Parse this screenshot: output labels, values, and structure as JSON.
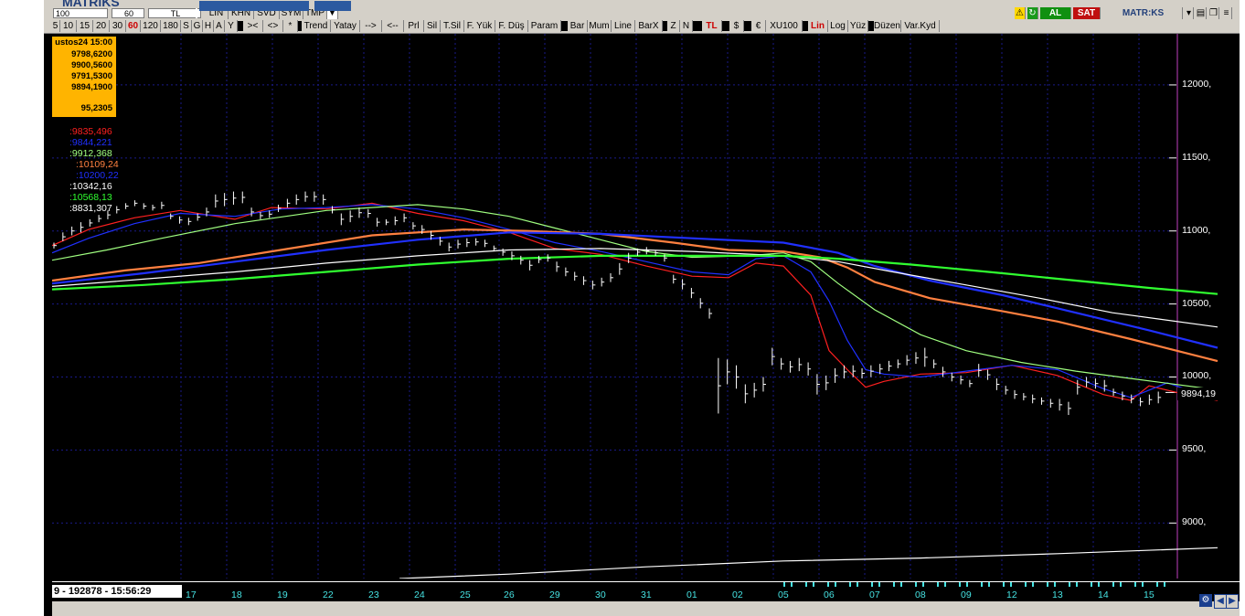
{
  "app": {
    "logo": "MATRiKS"
  },
  "toolbar1": {
    "fields": [
      "100",
      "60",
      "TL"
    ],
    "view_buttons": [
      "LIN",
      "KHN",
      "SVD",
      "SYM",
      "TMP"
    ],
    "field_a": "",
    "field_b": "",
    "al_label": "AL",
    "sat_label": "SAT",
    "logo_right": "MATR:KS"
  },
  "toolbar2": {
    "periods": [
      "5",
      "10",
      "15",
      "20",
      "30",
      "60",
      "120",
      "180",
      "S",
      "G",
      "H",
      "A",
      "Y"
    ],
    "active_period": "60",
    "nav": [
      "><",
      "<>",
      "*"
    ],
    "tools": [
      "Trend",
      "Yatay",
      "-->",
      "<--",
      "Prl",
      "Sil",
      "T.Sil",
      "F. Yük",
      "F. Düş",
      "Param"
    ],
    "chart_types": [
      "Bar",
      "Mum",
      "Line",
      "BarX"
    ],
    "z_label": "Z",
    "n_label": "N",
    "currency": [
      "TL",
      "$",
      "€",
      "XU100"
    ],
    "scale": [
      "Lin",
      "Log",
      "Yüz"
    ],
    "edit": [
      "Düzen",
      "Var.Kyd"
    ],
    "colors": {
      "active_text": "#cc0000"
    }
  },
  "info_box": {
    "date": "ustos24 15:00",
    "values": [
      "9798,6200",
      "9900,5600",
      "9791,5300",
      "9894,1900"
    ],
    "extra": "95,2305"
  },
  "legend": [
    {
      "text": ":9835,496",
      "color": "#ff2020"
    },
    {
      "text": ":9844,221",
      "color": "#2030ff"
    },
    {
      "text": ":9912,368",
      "color": "#a0ff80"
    },
    {
      "text": ":10109,24",
      "color": "#ff8040"
    },
    {
      "text": ":10200,22",
      "color": "#2030ff"
    },
    {
      "text": ":10342,16",
      "color": "#ffffff"
    },
    {
      "text": ":10568,13",
      "color": "#30ff30"
    },
    {
      "text": ":8831,307",
      "color": "#ffffff"
    }
  ],
  "y_axis": [
    "12000,",
    "11500,",
    "11000,",
    "10500,",
    "10000,",
    "9500,",
    "9000,"
  ],
  "last_price": "9894,19",
  "x_axis": [
    "17",
    "18",
    "19",
    "22",
    "23",
    "24",
    "25",
    "26",
    "29",
    "30",
    "31",
    "01",
    "02",
    "05",
    "06",
    "07",
    "08",
    "09",
    "12",
    "13",
    "14",
    "15"
  ],
  "status": "9 - 192878 - 15:56:29",
  "chart_data": {
    "type": "bar",
    "y_labels": [
      "12000,",
      "11500,",
      "11000,",
      "10500,",
      "10000,",
      "9500,",
      "9000,"
    ],
    "ylim": [
      8620,
      12350
    ],
    "x_labels": [
      "17",
      "18",
      "19",
      "22",
      "23",
      "24",
      "25",
      "26",
      "29",
      "30",
      "31",
      "01",
      "02",
      "05",
      "06",
      "07",
      "08",
      "09",
      "12",
      "13",
      "14",
      "15"
    ],
    "grid": true,
    "last_value": 9894.19,
    "price_bars": [
      [
        10880,
        10920
      ],
      [
        10930,
        10990
      ],
      [
        10970,
        11030
      ],
      [
        10990,
        11060
      ],
      [
        11030,
        11080
      ],
      [
        11060,
        11110
      ],
      [
        11080,
        11140
      ],
      [
        11120,
        11170
      ],
      [
        11150,
        11190
      ],
      [
        11170,
        11210
      ],
      [
        11150,
        11190
      ],
      [
        11140,
        11180
      ],
      [
        11150,
        11200
      ],
      [
        11080,
        11120
      ],
      [
        11050,
        11100
      ],
      [
        11040,
        11090
      ],
      [
        11070,
        11120
      ],
      [
        11100,
        11160
      ],
      [
        11160,
        11250
      ],
      [
        11170,
        11260
      ],
      [
        11180,
        11270
      ],
      [
        11190,
        11270
      ],
      [
        11100,
        11160
      ],
      [
        11080,
        11130
      ],
      [
        11090,
        11140
      ],
      [
        11130,
        11180
      ],
      [
        11160,
        11220
      ],
      [
        11180,
        11250
      ],
      [
        11200,
        11270
      ],
      [
        11200,
        11270
      ],
      [
        11180,
        11250
      ],
      [
        11120,
        11170
      ],
      [
        11040,
        11120
      ],
      [
        11060,
        11140
      ],
      [
        11090,
        11160
      ],
      [
        11090,
        11150
      ],
      [
        11030,
        11090
      ],
      [
        11040,
        11080
      ],
      [
        11040,
        11100
      ],
      [
        11060,
        11120
      ],
      [
        11010,
        11060
      ],
      [
        10980,
        11040
      ],
      [
        10940,
        11000
      ],
      [
        10900,
        10960
      ],
      [
        10860,
        10920
      ],
      [
        10880,
        10940
      ],
      [
        10890,
        10950
      ],
      [
        10900,
        10950
      ],
      [
        10890,
        10940
      ],
      [
        10860,
        10900
      ],
      [
        10830,
        10880
      ],
      [
        10800,
        10860
      ],
      [
        10770,
        10830
      ],
      [
        10730,
        10800
      ],
      [
        10780,
        10830
      ],
      [
        10790,
        10840
      ],
      [
        10720,
        10790
      ],
      [
        10690,
        10750
      ],
      [
        10660,
        10720
      ],
      [
        10630,
        10690
      ],
      [
        10600,
        10660
      ],
      [
        10620,
        10680
      ],
      [
        10650,
        10710
      ],
      [
        10700,
        10780
      ],
      [
        10780,
        10850
      ],
      [
        10830,
        10880
      ],
      [
        10840,
        10890
      ],
      [
        10830,
        10870
      ],
      [
        10790,
        10840
      ],
      [
        10640,
        10700
      ],
      [
        10600,
        10670
      ],
      [
        10540,
        10610
      ],
      [
        10470,
        10540
      ],
      [
        10400,
        10470
      ],
      [
        9750,
        10130
      ],
      [
        9950,
        10120
      ],
      [
        9920,
        10080
      ],
      [
        9820,
        9950
      ],
      [
        9860,
        9960
      ],
      [
        9900,
        10000
      ],
      [
        10080,
        10200
      ],
      [
        10050,
        10130
      ],
      [
        10030,
        10110
      ],
      [
        10040,
        10130
      ],
      [
        10010,
        10100
      ],
      [
        9880,
        10020
      ],
      [
        9910,
        10010
      ],
      [
        9960,
        10060
      ],
      [
        9990,
        10080
      ],
      [
        10000,
        10080
      ],
      [
        9990,
        10060
      ],
      [
        10000,
        10080
      ],
      [
        10020,
        10090
      ],
      [
        10040,
        10110
      ],
      [
        10060,
        10120
      ],
      [
        10080,
        10150
      ],
      [
        10090,
        10170
      ],
      [
        10070,
        10200
      ],
      [
        10060,
        10120
      ],
      [
        10000,
        10070
      ],
      [
        9970,
        10030
      ],
      [
        9950,
        10010
      ],
      [
        9930,
        9980
      ],
      [
        10000,
        10090
      ],
      [
        9980,
        10050
      ],
      [
        9910,
        9990
      ],
      [
        9880,
        9940
      ],
      [
        9850,
        9910
      ],
      [
        9840,
        9890
      ],
      [
        9820,
        9880
      ],
      [
        9810,
        9860
      ],
      [
        9790,
        9850
      ],
      [
        9770,
        9850
      ],
      [
        9740,
        9830
      ],
      [
        9880,
        9980
      ],
      [
        9930,
        10000
      ],
      [
        9920,
        9990
      ],
      [
        9900,
        9980
      ],
      [
        9870,
        9920
      ],
      [
        9840,
        9900
      ],
      [
        9820,
        9880
      ],
      [
        9800,
        9860
      ],
      [
        9810,
        9880
      ],
      [
        9820,
        9900
      ]
    ],
    "series": [
      {
        "color": "#ff2020",
        "values": [
          [
            0,
            10900
          ],
          [
            40,
            11010
          ],
          [
            90,
            11090
          ],
          [
            140,
            11140
          ],
          [
            200,
            11080
          ],
          [
            240,
            11160
          ],
          [
            300,
            11150
          ],
          [
            350,
            11190
          ],
          [
            400,
            11120
          ],
          [
            450,
            11070
          ],
          [
            500,
            10990
          ],
          [
            550,
            10880
          ],
          [
            600,
            10840
          ],
          [
            650,
            10760
          ],
          [
            700,
            10690
          ],
          [
            740,
            10680
          ],
          [
            770,
            10780
          ],
          [
            800,
            10760
          ],
          [
            830,
            10560
          ],
          [
            850,
            10180
          ],
          [
            870,
            10050
          ],
          [
            890,
            9930
          ],
          [
            910,
            9970
          ],
          [
            950,
            10020
          ],
          [
            1000,
            10030
          ],
          [
            1050,
            10080
          ],
          [
            1100,
            10010
          ],
          [
            1150,
            9880
          ],
          [
            1180,
            9840
          ],
          [
            1200,
            9940
          ],
          [
            1240,
            9880
          ],
          [
            1275,
            9840
          ]
        ]
      },
      {
        "color": "#2030ff",
        "values": [
          [
            0,
            10850
          ],
          [
            40,
            10950
          ],
          [
            90,
            11050
          ],
          [
            140,
            11120
          ],
          [
            200,
            11100
          ],
          [
            250,
            11150
          ],
          [
            300,
            11160
          ],
          [
            350,
            11180
          ],
          [
            400,
            11150
          ],
          [
            450,
            11090
          ],
          [
            500,
            11010
          ],
          [
            550,
            10920
          ],
          [
            600,
            10860
          ],
          [
            650,
            10790
          ],
          [
            700,
            10720
          ],
          [
            740,
            10700
          ],
          [
            770,
            10810
          ],
          [
            800,
            10830
          ],
          [
            830,
            10720
          ],
          [
            850,
            10520
          ],
          [
            870,
            10250
          ],
          [
            890,
            10050
          ],
          [
            910,
            10020
          ],
          [
            950,
            10000
          ],
          [
            1000,
            10040
          ],
          [
            1050,
            10080
          ],
          [
            1100,
            10050
          ],
          [
            1150,
            9920
          ],
          [
            1180,
            9860
          ],
          [
            1220,
            9960
          ],
          [
            1275,
            9845
          ]
        ]
      },
      {
        "color": "#a0ff80",
        "values": [
          [
            0,
            10800
          ],
          [
            60,
            10870
          ],
          [
            120,
            10950
          ],
          [
            200,
            11050
          ],
          [
            300,
            11140
          ],
          [
            400,
            11180
          ],
          [
            450,
            11150
          ],
          [
            500,
            11100
          ],
          [
            550,
            11020
          ],
          [
            600,
            10940
          ],
          [
            650,
            10860
          ],
          [
            700,
            10820
          ],
          [
            760,
            10830
          ],
          [
            800,
            10850
          ],
          [
            830,
            10790
          ],
          [
            860,
            10640
          ],
          [
            900,
            10460
          ],
          [
            950,
            10290
          ],
          [
            1000,
            10180
          ],
          [
            1060,
            10100
          ],
          [
            1120,
            10040
          ],
          [
            1180,
            9990
          ],
          [
            1275,
            9912
          ]
        ]
      },
      {
        "color": "#ff8040",
        "values": [
          [
            0,
            10660
          ],
          [
            80,
            10730
          ],
          [
            160,
            10780
          ],
          [
            250,
            10870
          ],
          [
            350,
            10970
          ],
          [
            450,
            11010
          ],
          [
            520,
            11000
          ],
          [
            600,
            10980
          ],
          [
            680,
            10920
          ],
          [
            740,
            10870
          ],
          [
            800,
            10860
          ],
          [
            840,
            10820
          ],
          [
            870,
            10750
          ],
          [
            900,
            10650
          ],
          [
            960,
            10540
          ],
          [
            1040,
            10450
          ],
          [
            1100,
            10380
          ],
          [
            1180,
            10260
          ],
          [
            1275,
            10109
          ]
        ]
      },
      {
        "color": "#2030ff",
        "values": [
          [
            0,
            10640
          ],
          [
            100,
            10710
          ],
          [
            200,
            10790
          ],
          [
            300,
            10870
          ],
          [
            400,
            10940
          ],
          [
            500,
            10990
          ],
          [
            600,
            10980
          ],
          [
            700,
            10950
          ],
          [
            800,
            10920
          ],
          [
            860,
            10850
          ],
          [
            900,
            10760
          ],
          [
            960,
            10660
          ],
          [
            1040,
            10560
          ],
          [
            1120,
            10440
          ],
          [
            1200,
            10320
          ],
          [
            1275,
            10200
          ]
        ]
      },
      {
        "color": "#ffffff",
        "values": [
          [
            0,
            10620
          ],
          [
            100,
            10670
          ],
          [
            200,
            10720
          ],
          [
            300,
            10780
          ],
          [
            400,
            10830
          ],
          [
            500,
            10870
          ],
          [
            600,
            10880
          ],
          [
            700,
            10860
          ],
          [
            800,
            10830
          ],
          [
            860,
            10790
          ],
          [
            920,
            10720
          ],
          [
            1000,
            10630
          ],
          [
            1080,
            10540
          ],
          [
            1160,
            10440
          ],
          [
            1275,
            10342
          ]
        ]
      },
      {
        "color": "#30ff30",
        "values": [
          [
            0,
            10600
          ],
          [
            100,
            10630
          ],
          [
            200,
            10670
          ],
          [
            300,
            10720
          ],
          [
            400,
            10770
          ],
          [
            500,
            10810
          ],
          [
            600,
            10830
          ],
          [
            700,
            10830
          ],
          [
            800,
            10830
          ],
          [
            860,
            10810
          ],
          [
            940,
            10770
          ],
          [
            1040,
            10710
          ],
          [
            1120,
            10660
          ],
          [
            1200,
            10610
          ],
          [
            1275,
            10568
          ]
        ]
      },
      {
        "color": "#ffffff",
        "values": [
          [
            380,
            8620
          ],
          [
            500,
            8650
          ],
          [
            650,
            8700
          ],
          [
            800,
            8740
          ],
          [
            950,
            8760
          ],
          [
            1100,
            8790
          ],
          [
            1275,
            8831
          ]
        ]
      }
    ]
  }
}
